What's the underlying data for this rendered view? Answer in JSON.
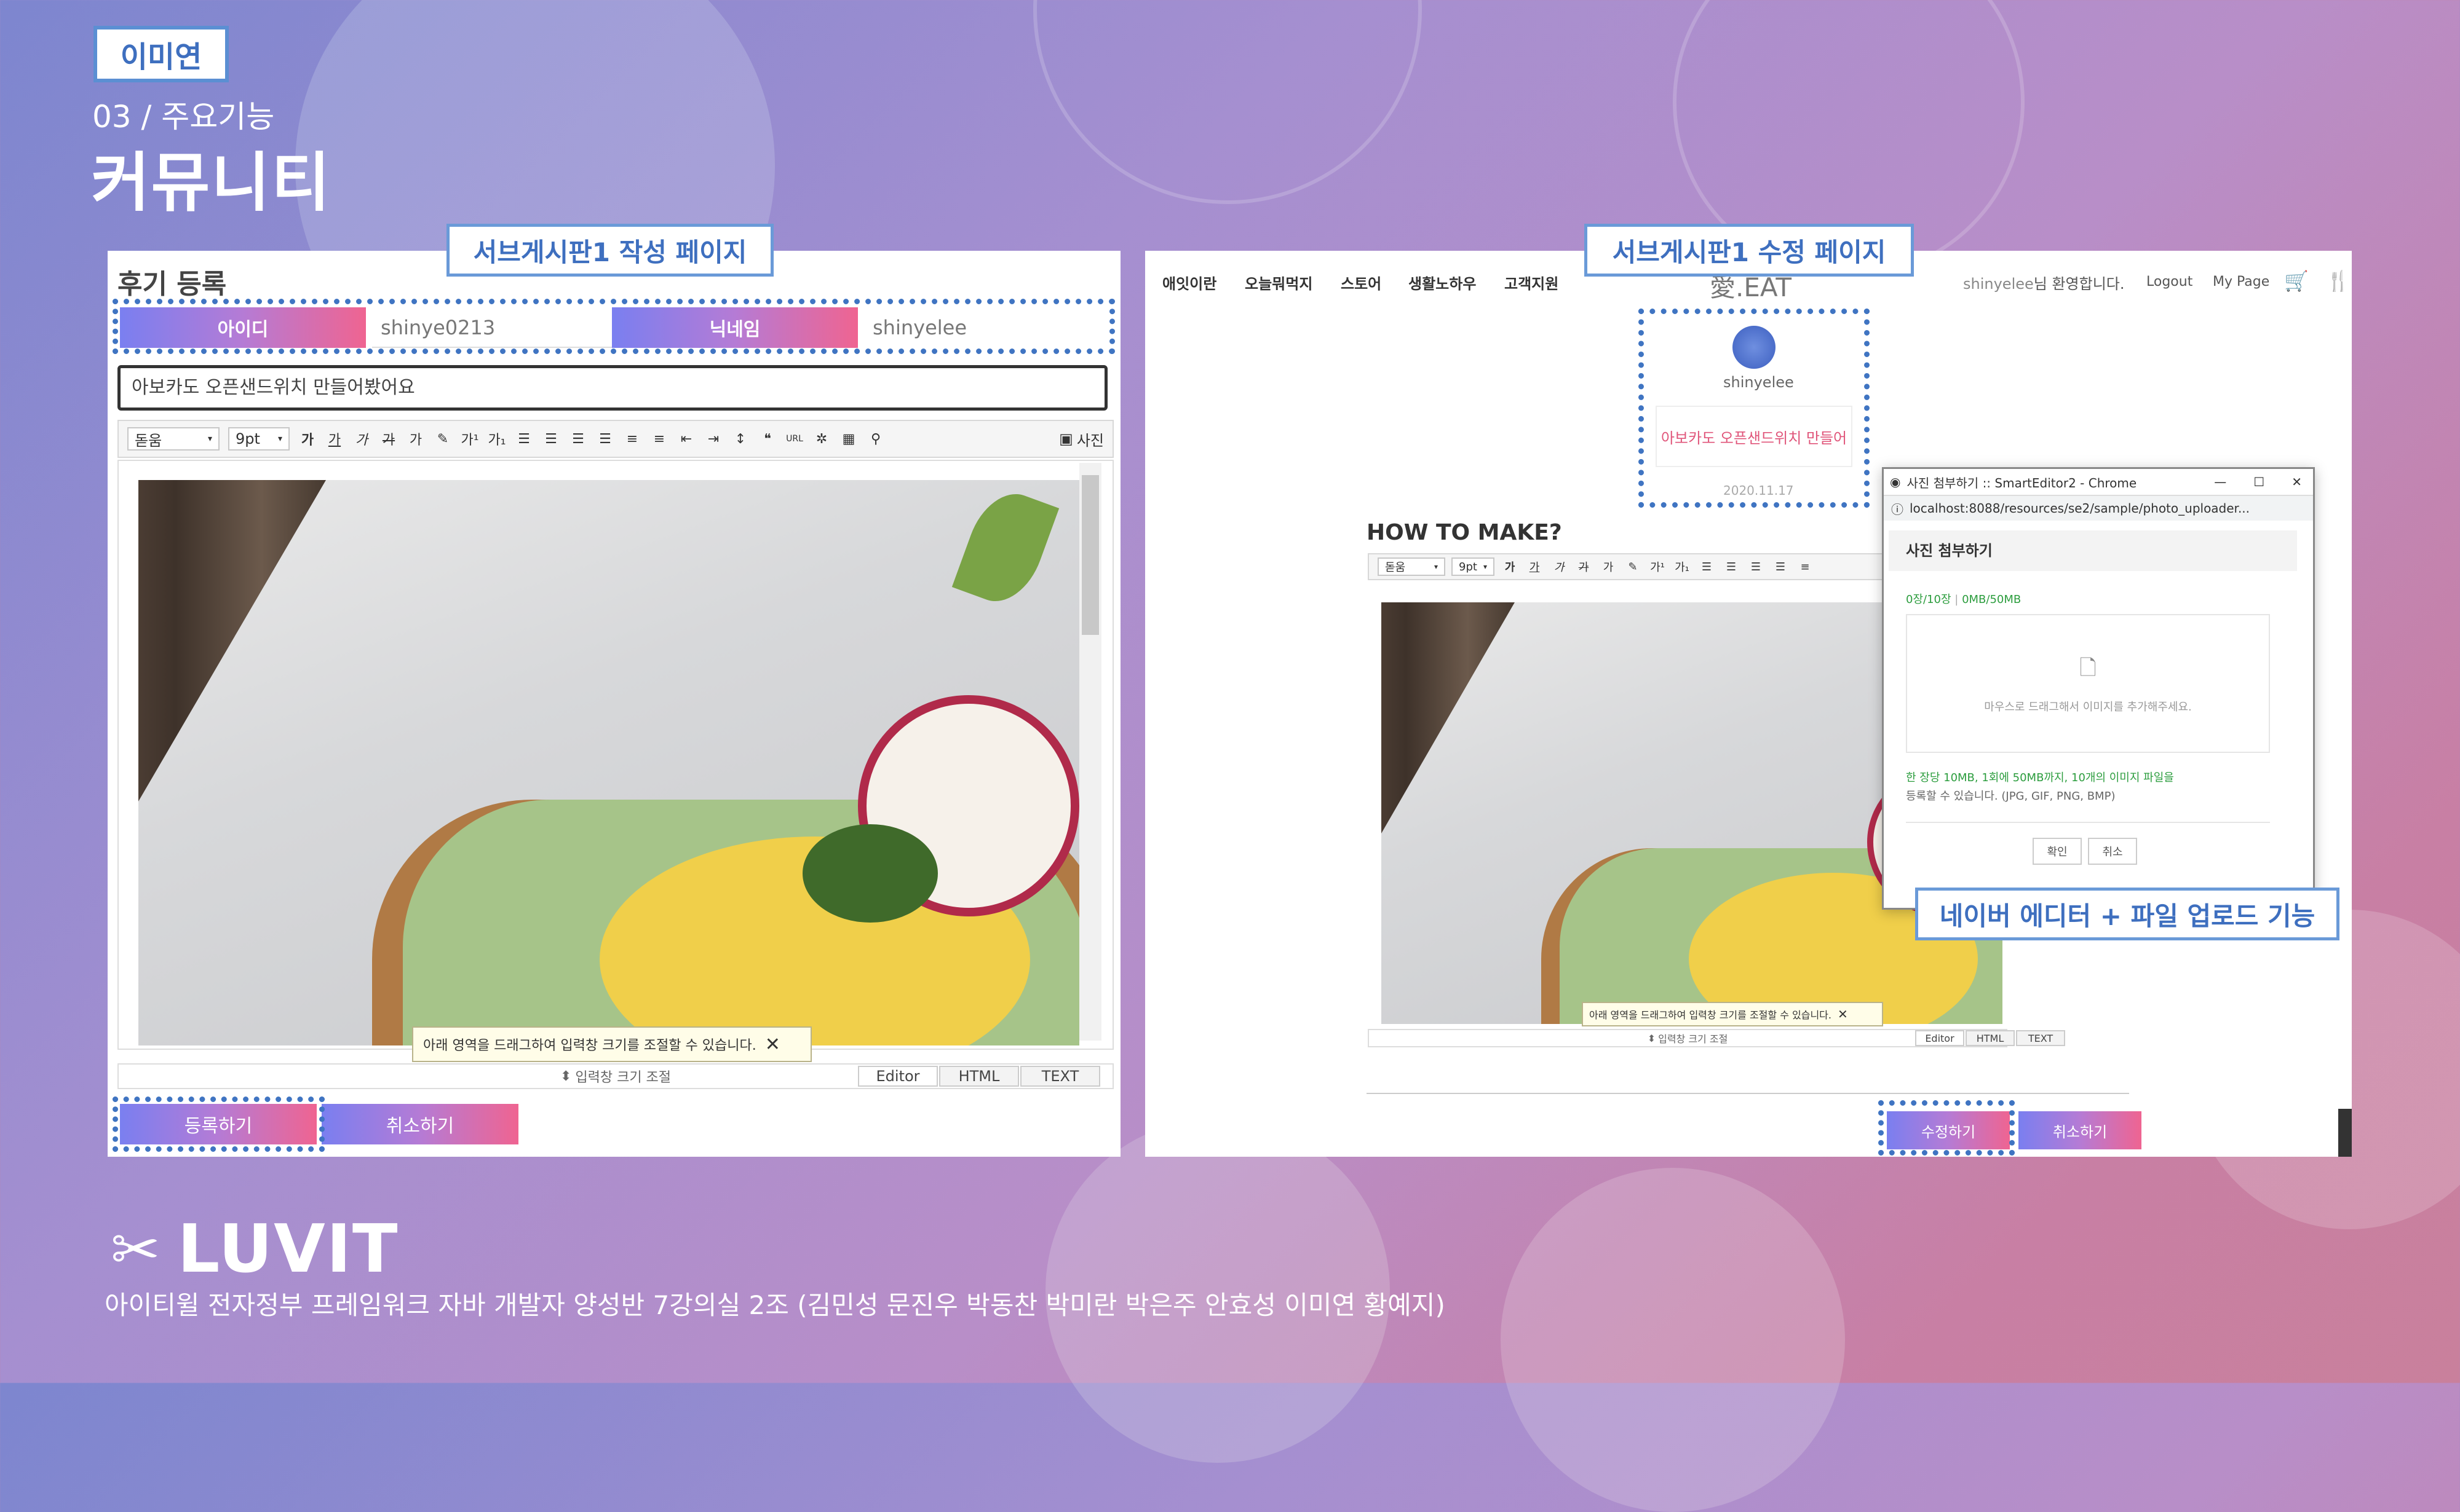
{
  "author": "이미연",
  "section": "03 / 주요기능",
  "page_title": "커뮤니티",
  "left": {
    "callout": "서브게시판1 작성 페이지",
    "heading": "후기 등록",
    "id_label": "아이디",
    "id_value": "shinye0213",
    "nick_label": "닉네임",
    "nick_value": "shinyelee",
    "post_title": "아보카도 오픈샌드위치 만들어봤어요",
    "font_select": "돋움",
    "size_select": "9pt",
    "photo_button": "사진",
    "tooltip": "아래 영역을 드래그하여 입력창 크기를 조절할 수 있습니다.",
    "resize": "입력창 크기 조절",
    "tabs": [
      "Editor",
      "HTML",
      "TEXT"
    ],
    "submit": "등록하기",
    "cancel": "취소하기"
  },
  "right": {
    "callout": "서브게시판1 수정 페이지",
    "nav": [
      "애잇이란",
      "오늘뭐먹지",
      "스토어",
      "생활노하우",
      "고객지원"
    ],
    "logo": "愛.EAT",
    "welcome_user": "shinyelee",
    "welcome_suffix": "님 환영합니다.",
    "logout": "Logout",
    "mypage": "My Page",
    "profile_name": "shinyelee",
    "profile_post": "아보카도 오픈샌드위치 만들어",
    "profile_date": "2020.11.17",
    "how": "HOW TO MAKE?",
    "font_select": "돋움",
    "size_select": "9pt",
    "tooltip": "아래 영역을 드래그하여 입력창 크기를 조절할 수 있습니다.",
    "resize": "입력창 크기 조절",
    "tabs": [
      "Editor",
      "HTML",
      "TEXT"
    ],
    "edit": "수정하기",
    "cancel": "취소하기",
    "popup": {
      "window_title": "사진 첨부하기 :: SmartEditor2 - Chrome",
      "url": "localhost:8088/resources/se2/sample/photo_uploader...",
      "header": "사진 첨부하기",
      "count": "0장/10장",
      "size": "0MB/50MB",
      "drop_hint": "마우스로 드래그해서 이미지를 추가해주세요.",
      "rule_line1": "한 장당 10MB, 1회에 50MB까지, 10개의 이미지 파일을",
      "rule_line2": "등록할 수 있습니다. (JPG, GIF, PNG, BMP)",
      "ok": "확인",
      "cancel": "취소"
    },
    "callout2": "네이버 에디터 + 파일 업로드 기능"
  },
  "footer": {
    "logo": "LUVIT",
    "text": "아이티윌 전자정부 프레임워크 자바 개발자 양성반 7강의실 2조 (김민성 문진우 박동찬 박미란 박은주 안효성 이미연 황예지)"
  },
  "colors": {
    "accent_blue": "#3f74c2",
    "gradient_start": "#7a7ff0",
    "gradient_end": "#ef6491"
  }
}
